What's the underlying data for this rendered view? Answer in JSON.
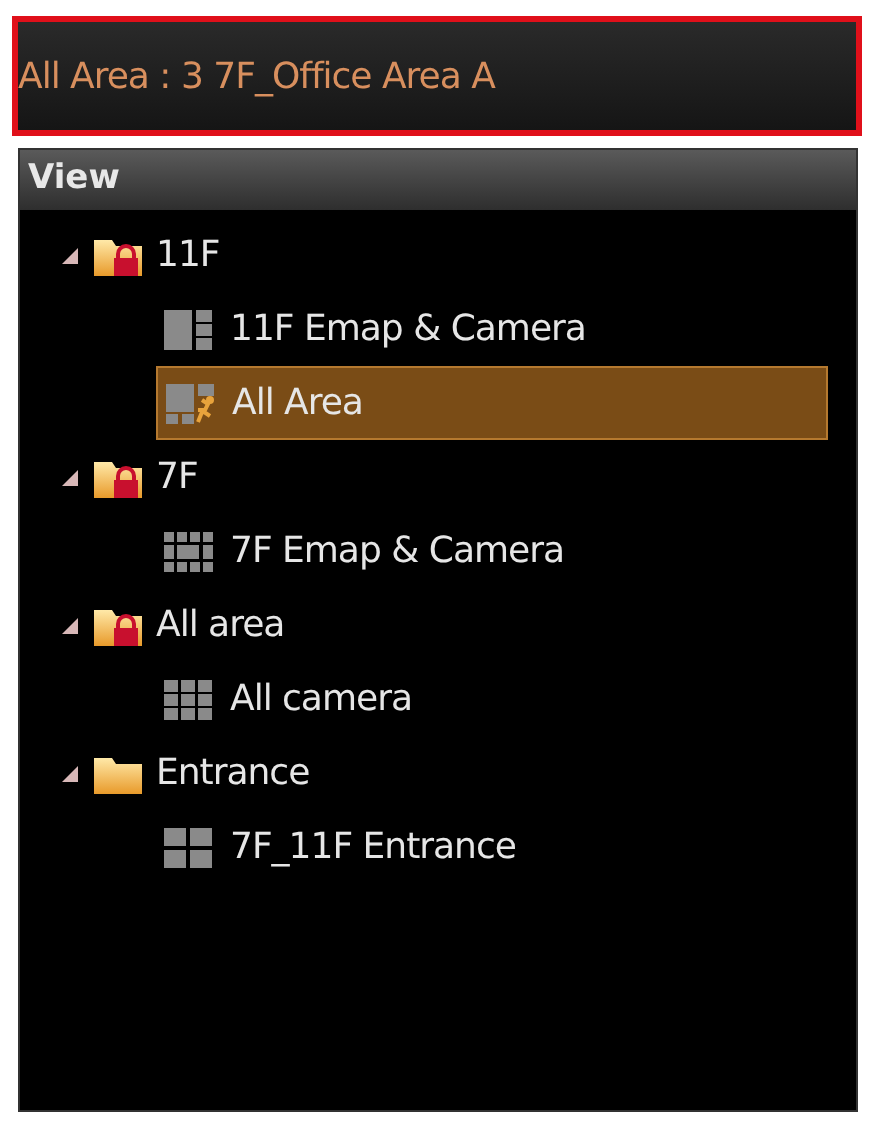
{
  "title_bar": {
    "text": "All Area : 3 7F_Office Area A"
  },
  "panel": {
    "header": "View",
    "tree": [
      {
        "label": "11F",
        "locked": true,
        "expanded": true,
        "children": [
          {
            "label": "11F Emap & Camera",
            "kind": "split",
            "selected": false
          },
          {
            "label": "All Area",
            "kind": "alarm",
            "selected": true
          }
        ]
      },
      {
        "label": "7F",
        "locked": true,
        "expanded": true,
        "children": [
          {
            "label": "7F Emap & Camera",
            "kind": "ring",
            "selected": false
          }
        ]
      },
      {
        "label": "All area",
        "locked": true,
        "expanded": true,
        "children": [
          {
            "label": "All camera",
            "kind": "grid3",
            "selected": false
          }
        ]
      },
      {
        "label": "Entrance",
        "locked": false,
        "expanded": true,
        "children": [
          {
            "label": "7F_11F Entrance",
            "kind": "grid2",
            "selected": false
          }
        ]
      }
    ]
  }
}
